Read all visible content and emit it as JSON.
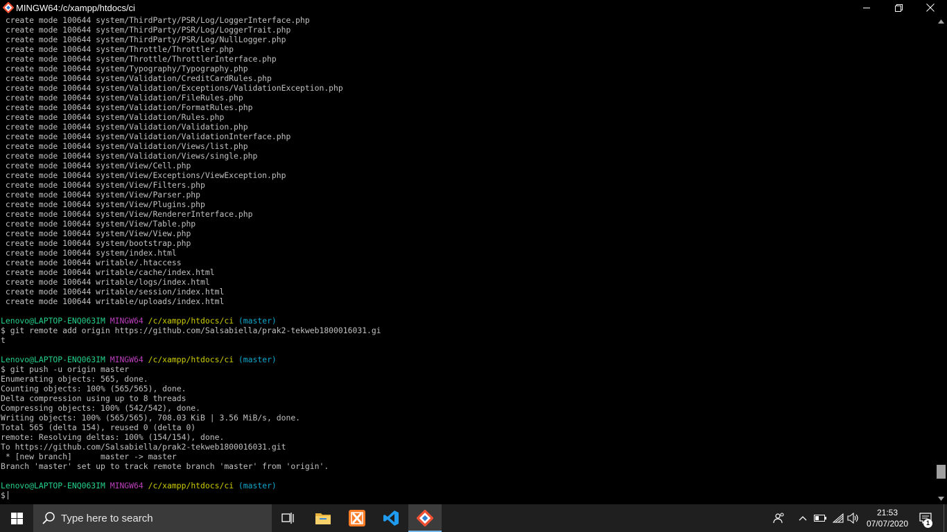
{
  "window": {
    "title": "MINGW64:/c/xampp/htdocs/ci",
    "icon": "git-bash-icon",
    "controls": [
      "minimize-icon",
      "restore-icon",
      "close-icon"
    ]
  },
  "terminal": {
    "colors": {
      "text": "#c0c0c0",
      "user": "#23d18b",
      "system": "#bc3fbc",
      "path": "#cdcd00",
      "branch": "#11a8cd"
    },
    "lines": [
      {
        "type": "out",
        "text": " create mode 100644 system/ThirdParty/PSR/Log/LoggerInterface.php"
      },
      {
        "type": "out",
        "text": " create mode 100644 system/ThirdParty/PSR/Log/LoggerTrait.php"
      },
      {
        "type": "out",
        "text": " create mode 100644 system/ThirdParty/PSR/Log/NullLogger.php"
      },
      {
        "type": "out",
        "text": " create mode 100644 system/Throttle/Throttler.php"
      },
      {
        "type": "out",
        "text": " create mode 100644 system/Throttle/ThrottlerInterface.php"
      },
      {
        "type": "out",
        "text": " create mode 100644 system/Typography/Typography.php"
      },
      {
        "type": "out",
        "text": " create mode 100644 system/Validation/CreditCardRules.php"
      },
      {
        "type": "out",
        "text": " create mode 100644 system/Validation/Exceptions/ValidationException.php"
      },
      {
        "type": "out",
        "text": " create mode 100644 system/Validation/FileRules.php"
      },
      {
        "type": "out",
        "text": " create mode 100644 system/Validation/FormatRules.php"
      },
      {
        "type": "out",
        "text": " create mode 100644 system/Validation/Rules.php"
      },
      {
        "type": "out",
        "text": " create mode 100644 system/Validation/Validation.php"
      },
      {
        "type": "out",
        "text": " create mode 100644 system/Validation/ValidationInterface.php"
      },
      {
        "type": "out",
        "text": " create mode 100644 system/Validation/Views/list.php"
      },
      {
        "type": "out",
        "text": " create mode 100644 system/Validation/Views/single.php"
      },
      {
        "type": "out",
        "text": " create mode 100644 system/View/Cell.php"
      },
      {
        "type": "out",
        "text": " create mode 100644 system/View/Exceptions/ViewException.php"
      },
      {
        "type": "out",
        "text": " create mode 100644 system/View/Filters.php"
      },
      {
        "type": "out",
        "text": " create mode 100644 system/View/Parser.php"
      },
      {
        "type": "out",
        "text": " create mode 100644 system/View/Plugins.php"
      },
      {
        "type": "out",
        "text": " create mode 100644 system/View/RendererInterface.php"
      },
      {
        "type": "out",
        "text": " create mode 100644 system/View/Table.php"
      },
      {
        "type": "out",
        "text": " create mode 100644 system/View/View.php"
      },
      {
        "type": "out",
        "text": " create mode 100644 system/bootstrap.php"
      },
      {
        "type": "out",
        "text": " create mode 100644 system/index.html"
      },
      {
        "type": "out",
        "text": " create mode 100644 writable/.htaccess"
      },
      {
        "type": "out",
        "text": " create mode 100644 writable/cache/index.html"
      },
      {
        "type": "out",
        "text": " create mode 100644 writable/logs/index.html"
      },
      {
        "type": "out",
        "text": " create mode 100644 writable/session/index.html"
      },
      {
        "type": "out",
        "text": " create mode 100644 writable/uploads/index.html"
      },
      {
        "type": "blank",
        "text": ""
      },
      {
        "type": "prompt",
        "user": "Lenovo@LAPTOP-ENQ063IM",
        "system": "MINGW64",
        "path": "/c/xampp/htdocs/ci",
        "branch": "(master)"
      },
      {
        "type": "out",
        "text": "$ git remote add origin https://github.com/Salsabiella/prak2-tekweb1800016031.gi"
      },
      {
        "type": "out",
        "text": "t"
      },
      {
        "type": "blank",
        "text": ""
      },
      {
        "type": "prompt",
        "user": "Lenovo@LAPTOP-ENQ063IM",
        "system": "MINGW64",
        "path": "/c/xampp/htdocs/ci",
        "branch": "(master)"
      },
      {
        "type": "out",
        "text": "$ git push -u origin master"
      },
      {
        "type": "out",
        "text": "Enumerating objects: 565, done."
      },
      {
        "type": "out",
        "text": "Counting objects: 100% (565/565), done."
      },
      {
        "type": "out",
        "text": "Delta compression using up to 8 threads"
      },
      {
        "type": "out",
        "text": "Compressing objects: 100% (542/542), done."
      },
      {
        "type": "out",
        "text": "Writing objects: 100% (565/565), 708.03 KiB | 3.56 MiB/s, done."
      },
      {
        "type": "out",
        "text": "Total 565 (delta 154), reused 0 (delta 0)"
      },
      {
        "type": "out",
        "text": "remote: Resolving deltas: 100% (154/154), done."
      },
      {
        "type": "out",
        "text": "To https://github.com/Salsabiella/prak2-tekweb1800016031.git"
      },
      {
        "type": "out",
        "text": " * [new branch]      master -> master"
      },
      {
        "type": "out",
        "text": "Branch 'master' set up to track remote branch 'master' from 'origin'."
      },
      {
        "type": "blank",
        "text": ""
      },
      {
        "type": "prompt",
        "user": "Lenovo@LAPTOP-ENQ063IM",
        "system": "MINGW64",
        "path": "/c/xampp/htdocs/ci",
        "branch": "(master)"
      },
      {
        "type": "input",
        "text": "$"
      }
    ]
  },
  "scrollbar": {
    "position_fraction": 0.97
  },
  "taskbar": {
    "search_placeholder": "Type here to search",
    "apps": [
      "task-view-icon",
      "file-explorer-icon",
      "xampp-icon",
      "vscode-icon",
      "git-bash-icon"
    ],
    "active_app": "git-bash-icon",
    "tray": [
      "people-icon",
      "chevron-up-icon",
      "battery-icon",
      "wifi-icon",
      "volume-icon"
    ],
    "time": "21:53",
    "date": "07/07/2020",
    "notification_count": "1",
    "accent": "#76b9ed"
  }
}
